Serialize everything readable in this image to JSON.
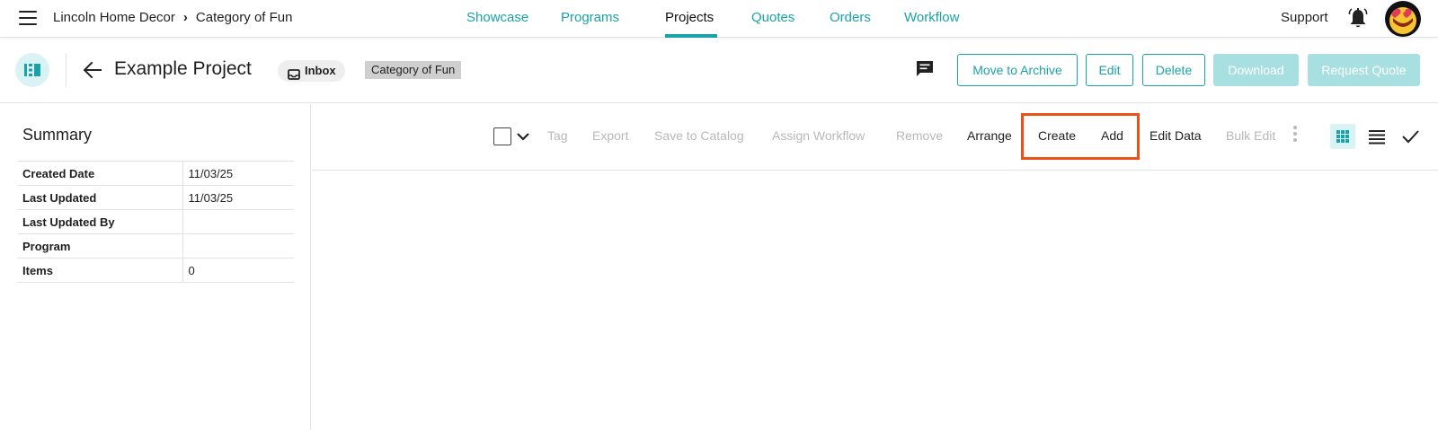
{
  "topnav": {
    "breadcrumb": [
      "Lincoln Home Decor",
      "Category of Fun"
    ],
    "tabs": [
      {
        "label": "Showcase",
        "active": false
      },
      {
        "label": "Programs",
        "active": false
      },
      {
        "label": "Projects",
        "active": true
      },
      {
        "label": "Quotes",
        "active": false
      },
      {
        "label": "Orders",
        "active": false
      },
      {
        "label": "Workflow",
        "active": false
      }
    ],
    "support_label": "Support"
  },
  "project": {
    "title": "Example Project",
    "inbox_label": "Inbox",
    "category_tag": "Category of Fun",
    "buttons": {
      "archive": "Move to Archive",
      "edit": "Edit",
      "delete": "Delete",
      "download": "Download",
      "request_quote": "Request Quote"
    }
  },
  "summary": {
    "title": "Summary",
    "rows": [
      {
        "key": "Created Date",
        "value": "11/03/25"
      },
      {
        "key": "Last Updated",
        "value": "11/03/25"
      },
      {
        "key": "Last Updated By",
        "value": ""
      },
      {
        "key": "Program",
        "value": ""
      },
      {
        "key": "Items",
        "value": "0"
      }
    ]
  },
  "toolbar": {
    "tag": "Tag",
    "export": "Export",
    "save_to_catalog": "Save to Catalog",
    "assign_workflow": "Assign Workflow",
    "remove": "Remove",
    "arrange": "Arrange",
    "create": "Create",
    "add": "Add",
    "edit_data": "Edit Data",
    "bulk_edit": "Bulk Edit"
  },
  "colors": {
    "accent": "#1aa2a8",
    "accent_light": "#a8e0e2",
    "highlight": "#e8521a"
  }
}
